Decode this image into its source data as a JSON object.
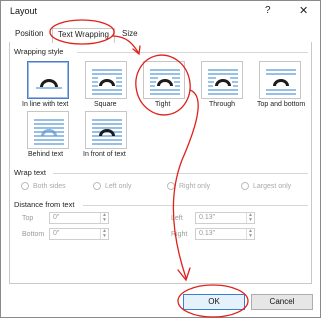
{
  "window": {
    "title": "Layout",
    "help_glyph": "?",
    "close_glyph": "✕"
  },
  "tabs": [
    {
      "label": "Position",
      "active": false
    },
    {
      "label": "Text Wrapping",
      "active": true
    },
    {
      "label": "Size",
      "active": false
    }
  ],
  "wrapping_style": {
    "heading": "Wrapping style",
    "options": [
      {
        "label": "In line with text",
        "icon": "inline-wrap-icon",
        "selected": true
      },
      {
        "label": "Square",
        "icon": "square-wrap-icon",
        "selected": false
      },
      {
        "label": "Tight",
        "icon": "tight-wrap-icon",
        "selected": false
      },
      {
        "label": "Through",
        "icon": "through-wrap-icon",
        "selected": false
      },
      {
        "label": "Top and bottom",
        "icon": "top-bottom-wrap-icon",
        "selected": false
      },
      {
        "label": "Behind text",
        "icon": "behind-text-icon",
        "selected": false
      },
      {
        "label": "In front of text",
        "icon": "in-front-text-icon",
        "selected": false
      }
    ]
  },
  "wrap_text": {
    "heading": "Wrap text",
    "options": [
      "Both sides",
      "Left only",
      "Right only",
      "Largest only"
    ]
  },
  "distance": {
    "heading": "Distance from text",
    "top_label": "Top",
    "top_value": "0\"",
    "bottom_label": "Bottom",
    "bottom_value": "0\"",
    "left_label": "Left",
    "left_value": "0.13\"",
    "right_label": "Right",
    "right_value": "0.13\""
  },
  "buttons": {
    "ok": "OK",
    "cancel": "Cancel"
  },
  "colors": {
    "accent": "#3c7fd0",
    "icon_lines": "#5b9bd5",
    "annotation": "#e0201b"
  }
}
